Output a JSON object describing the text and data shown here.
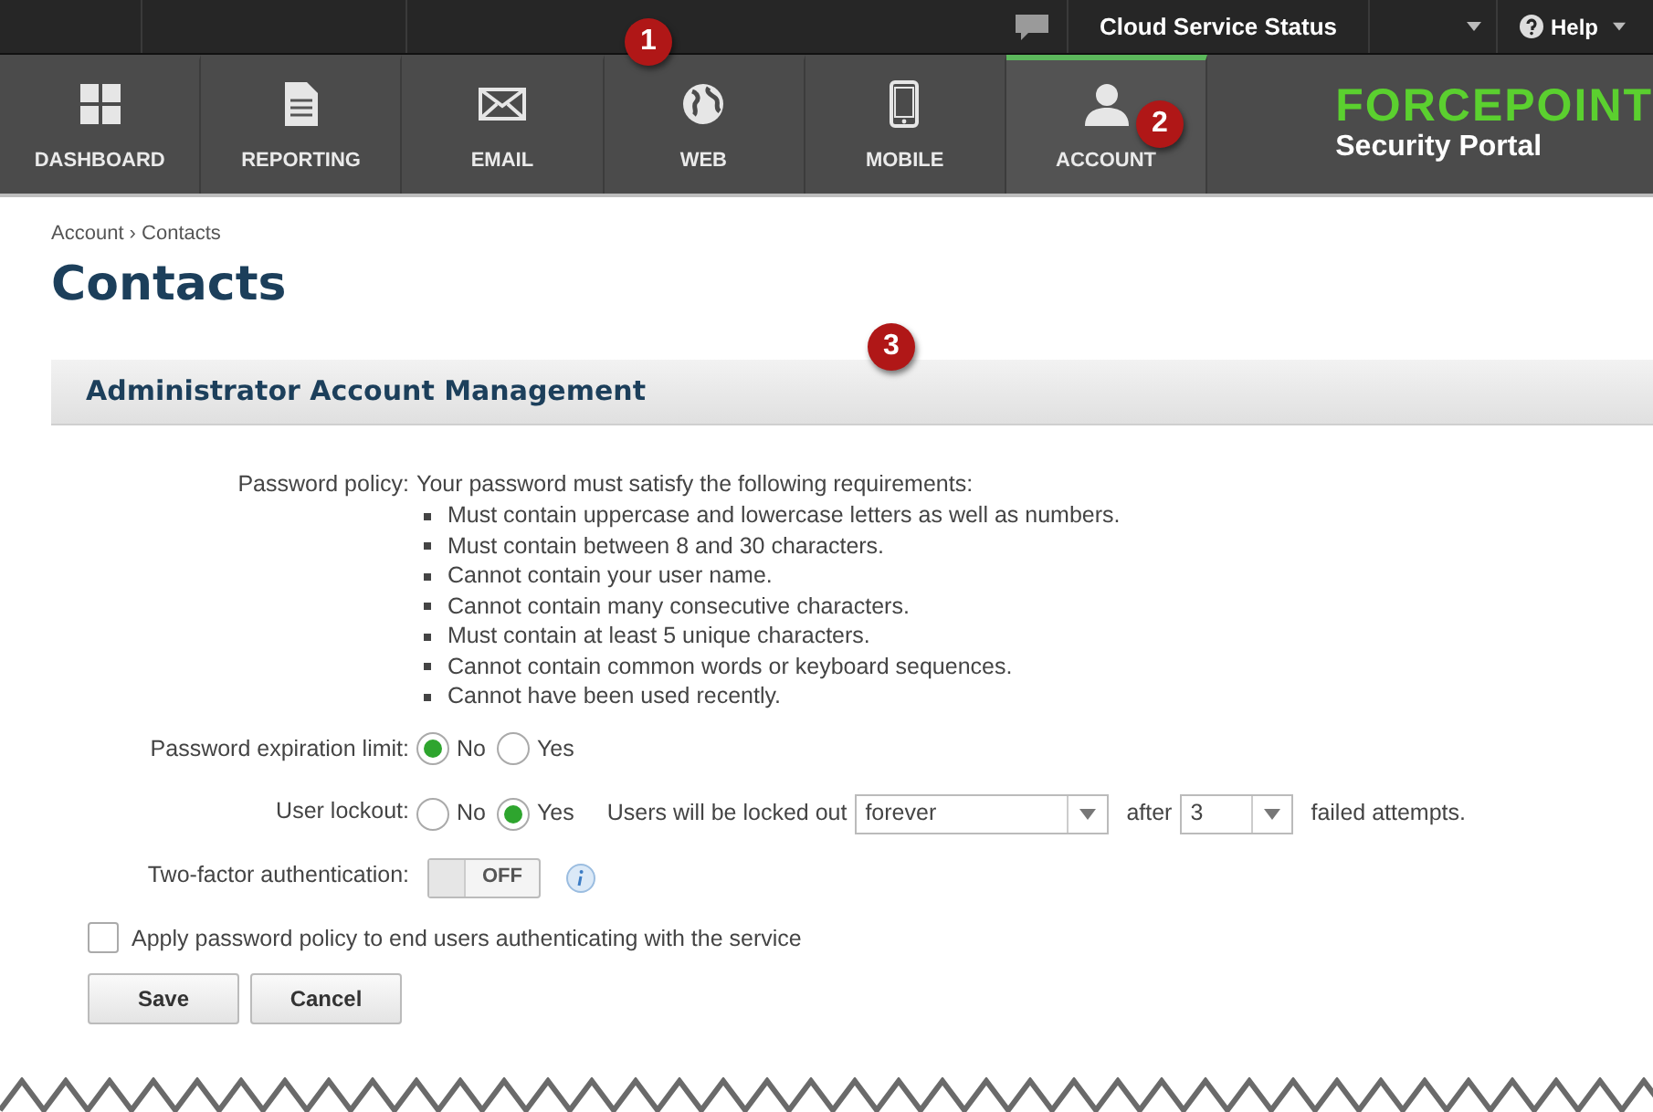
{
  "top_bar": {
    "status_link": "Cloud Service Status",
    "help": "Help"
  },
  "nav_tabs": [
    {
      "label": "DASHBOARD",
      "kind": "grid",
      "selected": false
    },
    {
      "label": "REPORTING",
      "kind": "document",
      "selected": false
    },
    {
      "label": "EMAIL",
      "kind": "envelope",
      "selected": false
    },
    {
      "label": "WEB",
      "kind": "globe",
      "selected": false
    },
    {
      "label": "MOBILE",
      "kind": "phone",
      "selected": false
    },
    {
      "label": "ACCOUNT",
      "kind": "person",
      "selected": true
    }
  ],
  "logo": {
    "brand": "FORCEPOINT",
    "subtitle": "Security Portal"
  },
  "callouts": [
    "1",
    "2",
    "3"
  ],
  "breadcrumb": "Account › Contacts",
  "page_title": "Contacts",
  "section_title": "Administrator Account Management",
  "password_policy": {
    "label": "Password policy:",
    "intro": "Your password must satisfy the following requirements:",
    "requirements": [
      "Must contain uppercase and lowercase letters as well as numbers.",
      "Must contain between 8 and 30 characters.",
      "Cannot contain your user name.",
      "Cannot contain many consecutive characters.",
      "Must contain at least 5 unique characters.",
      "Cannot contain common words or keyboard sequences.",
      "Cannot have been used recently."
    ]
  },
  "expiration": {
    "label": "Password expiration limit:",
    "options": [
      {
        "label": "No",
        "selected": true
      },
      {
        "label": "Yes",
        "selected": false
      }
    ]
  },
  "lockout": {
    "label": "User lockout:",
    "options": [
      {
        "label": "No",
        "selected": false
      },
      {
        "label": "Yes",
        "selected": true
      }
    ],
    "text_before": "Users will be locked out",
    "duration": "forever",
    "text_middle": "after",
    "attempts": "3",
    "text_after": "failed attempts."
  },
  "two_factor": {
    "label": "Two-factor authentication:",
    "on": false,
    "state_text": "OFF"
  },
  "apply_policy": {
    "label": "Apply password policy to end users authenticating with the service",
    "checked": false
  },
  "buttons": [
    "Save",
    "Cancel"
  ]
}
